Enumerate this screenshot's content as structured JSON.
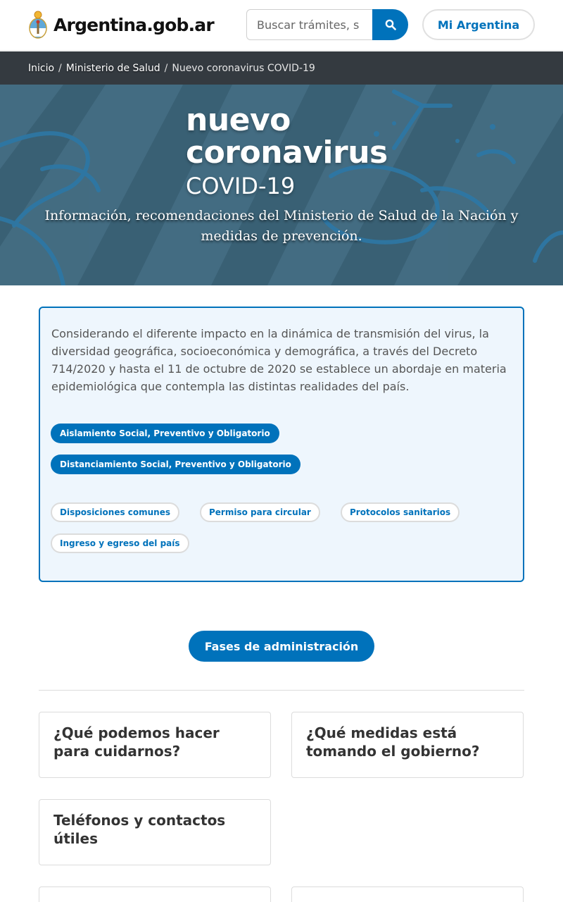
{
  "header": {
    "logo_text": "Argentina.gob.ar",
    "search_placeholder": "Buscar trámites, s",
    "search_icon": "search-icon",
    "account_label": "Mi Argentina"
  },
  "breadcrumb": {
    "items": [
      "Inicio",
      "Ministerio de Salud"
    ],
    "current": "Nuevo coronavirus COVID-19"
  },
  "hero": {
    "line1": "nuevo",
    "line2": "coronavirus",
    "line3": "COVID-19",
    "subtitle": "Información, recomendaciones del Ministerio de Salud de la Nación y medidas de prevención."
  },
  "panel": {
    "text": "Considerando el diferente impacto en la dinámica de transmisión del virus, la diversidad geográfica, socioeconómica y demográfica, a través del Decreto 714/2020 y hasta el 11 de octubre de 2020 se establece un abordaje en materia epidemiológica que contempla las distintas realidades del país.",
    "primary_pills": [
      "Aislamiento Social, Preventivo y Obligatorio",
      "Distanciamiento Social, Preventivo y Obligatorio"
    ],
    "secondary_pills": [
      "Disposiciones comunes",
      "Permiso para circular",
      "Protocolos sanitarios",
      "Ingreso y egreso del país"
    ]
  },
  "fases_label": "Fases de administración",
  "cards": [
    "¿Qué podemos hacer para cuidarnos?",
    "¿Qué medidas está tomando el gobierno?",
    "Teléfonos y contactos útiles"
  ],
  "colors": {
    "primary": "#0072bb",
    "breadcrumb_bg": "#343a40",
    "panel_bg": "#eef6fd"
  }
}
